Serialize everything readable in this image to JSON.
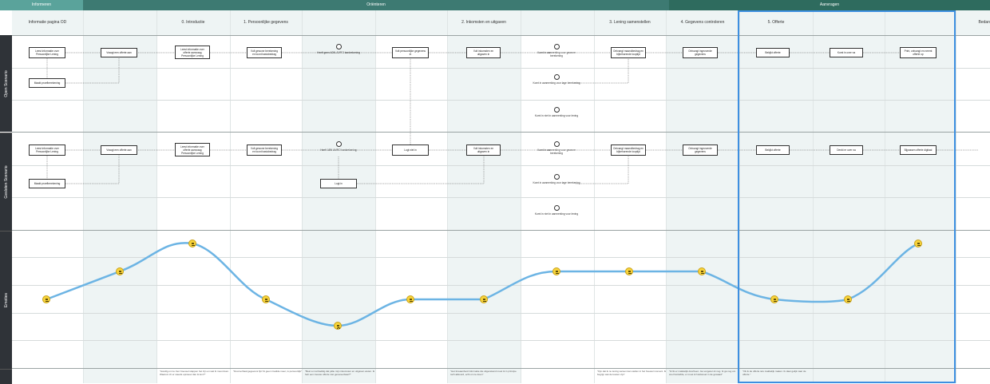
{
  "phases": [
    "Informeren",
    "Oriënteren",
    "Aanvragen"
  ],
  "colors": {
    "informeren": "#5aa39b",
    "orienteren": "#3d7a72",
    "aanvragen": "#2e6b5e",
    "highlight": "#3d8fe0",
    "curve": "#6cb4e4"
  },
  "stages": [
    "Informatie pagina OD",
    "",
    "0. Introductie",
    "1. Persoonlijke gegevens",
    "",
    "",
    "2. Inkomsten en uitgaven",
    "",
    "3. Lening samenstellen",
    "4. Gegevens controleren",
    "5. Offerte",
    "",
    "",
    "Bedan"
  ],
  "lanes": [
    "Open Scenario",
    "Gesloten Scenario",
    "Emoties"
  ],
  "open": {
    "boxes": [
      "Leest informatie over Persoonlijke Lening",
      "Vraagt een offerte aan",
      "Leest informatie over offerte aanvraag Persoonlijke Lening",
      "Vult gewone berekening en toont basisbedrag",
      "Vult persoonlijke gegevens in",
      "Vult inkomsten en uitgaven in",
      "Ontvangt maandbedrag en bijbehorende looptijd",
      "Ontvangt ingevoerde gegevens",
      "Bekijkt offerte",
      "Komt in over na",
      "Print, ontvangt en neemt offerte op",
      "Maakt proefberekening"
    ],
    "circles": [
      "Heeft geen ADN-AMRO bankrekening",
      "Komt in aanmerking voor gewone berekening",
      "Komt in aanmerking voor lage berekening",
      "Komt in niet in aanmerking voor lening"
    ]
  },
  "closed": {
    "boxes": [
      "Leest informatie over Persoonlijke Lening",
      "Vraagt een offerte aan",
      "Leest informatie over offerte aanvraag Persoonlijke Lening",
      "Vult gewone berekening en toont basisbedrag",
      "Logt niet in",
      "Vult inkomsten en uitgaven in",
      "Ontvangt maandbedrag en bijbehorende looptijd",
      "Ontvangt ingevoerde gegevens",
      "Bekijkt offerte",
      "Denkt er over na",
      "Bijpassen offerte digitaal",
      "Maakt proefberekening",
      "Logt in"
    ],
    "circles": [
      "Heeft ABN AMRO bankrekening",
      "Komt in aanmerking voor gewone berekening",
      "Komt in aanmerking voor lage berekening",
      "Komt in niet in aanmerking voor lening"
    ]
  },
  "emotions": [
    "neutral",
    "happy",
    "happy",
    "happy",
    "sad",
    "happy",
    "neutral",
    "happy",
    "happy",
    "happy",
    "happy",
    "happy",
    "happy"
  ],
  "quotes": [
    "\"Handig om te zien hoeveel stappen het zijn en wat ik moet doen. Waarom zit er steeds opnieuw dan ik kon?\"",
    "\"Doorverhaal gegevens fijn! Ik geen invalide meer, is persoonlijk\"",
    "\"Best a monhaddig dat jullie mijn inkomsten en uitgaven weten. Ik heb een nieuwe offerte niet genereerbaar?\"",
    "\"Het foreaanheid informatie die uitgerekend moet ik in principe toch akkoord, echt om te doen\"",
    "\"Fijn dat ik nu lening samen kan stellen in het hoewel moment. Ik begrijp wat de kosten zijn\"",
    "\"Ik lik er makkelijk doorheen. Ga vergeten ik nog. Ik ga nog om snel hetzelfde, er moet ik huidoneel in de gewaad\"",
    "\"Ok ik de offerte iets makkelijk maken. Ik daar gelijk naar de offerte.\""
  ]
}
